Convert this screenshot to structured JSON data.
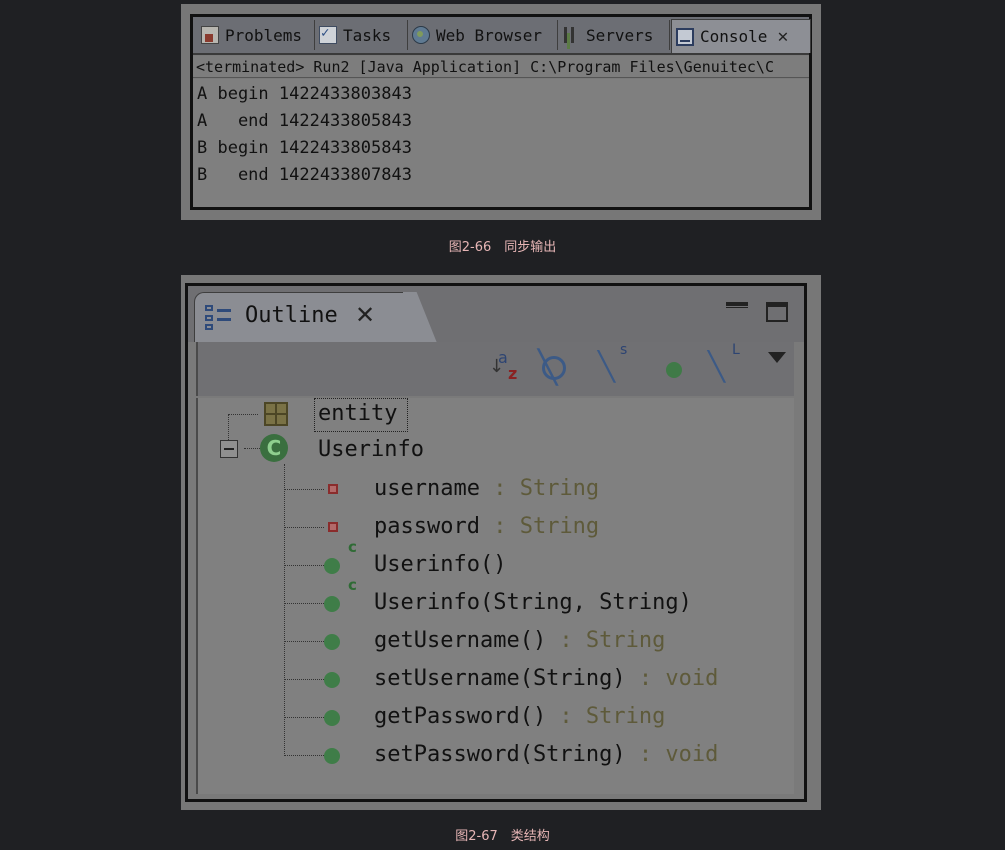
{
  "console_figure": {
    "tabs": [
      {
        "label": "Problems",
        "icon": "problems-icon"
      },
      {
        "label": "Tasks",
        "icon": "tasks-icon"
      },
      {
        "label": "Web Browser",
        "icon": "web-browser-icon"
      },
      {
        "label": "Servers",
        "icon": "servers-icon"
      },
      {
        "label": "Console",
        "icon": "console-icon",
        "active": true
      }
    ],
    "close_glyph": "✕",
    "status": "<terminated> Run2 [Java Application] C:\\Program Files\\Genuitec\\C",
    "lines": [
      "A begin 1422433803843",
      "A   end 1422433805843",
      "B begin 1422433805843",
      "B   end 1422433807843"
    ],
    "caption": "图2-66　同步输出"
  },
  "outline_figure": {
    "tab_title": "Outline",
    "close_glyph": "✕",
    "toolbar": {
      "sort_a": "a",
      "sort_z": "z",
      "static_mark": "s",
      "local_mark": "L"
    },
    "package": "entity",
    "class_name": "Userinfo",
    "class_icon_letter": "C",
    "ctor_mark": "c",
    "members": [
      {
        "kind": "field",
        "name": "username",
        "type": " : String"
      },
      {
        "kind": "field",
        "name": "password",
        "type": " : String"
      },
      {
        "kind": "constructor",
        "name": "Userinfo()",
        "type": ""
      },
      {
        "kind": "constructor",
        "name": "Userinfo(String, String)",
        "type": ""
      },
      {
        "kind": "method",
        "name": "getUsername()",
        "type": " : String"
      },
      {
        "kind": "method",
        "name": "setUsername(String)",
        "type": " : void"
      },
      {
        "kind": "method",
        "name": "getPassword()",
        "type": " : String"
      },
      {
        "kind": "method",
        "name": "setPassword(String)",
        "type": " : void"
      }
    ],
    "caption": "图2-67　类结构"
  },
  "colors": {
    "background": "#1f2023",
    "caption": "#e6b5b5",
    "method_green": "#3f7d48",
    "field_red": "#8a2c2c"
  }
}
